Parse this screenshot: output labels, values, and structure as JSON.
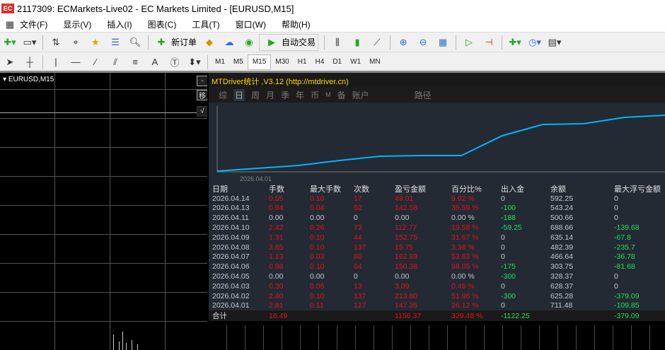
{
  "window": {
    "title": "2117309: ECMarkets-Live02 - EC Markets Limited - [EURUSD,M15]",
    "logo": "EC"
  },
  "menu": [
    "文件(F)",
    "显示(V)",
    "插入(I)",
    "图表(C)",
    "工具(T)",
    "窗口(W)",
    "帮助(H)"
  ],
  "toolbar": {
    "new_order": "新订单",
    "auto_trading": "自动交易"
  },
  "drawing_tools": {
    "text_tool": "A"
  },
  "timeframes": [
    "M1",
    "M5",
    "M15",
    "M30",
    "H1",
    "H4",
    "D1",
    "W1",
    "MN"
  ],
  "active_timeframe": "M15",
  "chart": {
    "symbol": "EURUSD,M15",
    "side_buttons": [
      "-",
      "移",
      "√"
    ]
  },
  "panel": {
    "title": "MTDriver统计 ,V3.12 (http://mtdriver.cn)",
    "tabs": [
      "综",
      "日",
      "周",
      "月",
      "季",
      "年",
      "币",
      "M",
      "备",
      "账户",
      "路径"
    ],
    "active_tab": "日",
    "chart_label": "2026.04.01",
    "equity_curve": [
      0,
      4,
      8,
      15,
      21,
      22,
      22,
      50,
      66,
      67,
      76,
      79
    ],
    "columns": [
      "日期",
      "手数",
      "最大手数",
      "次数",
      "盈亏金额",
      "百分比%",
      "出入金",
      "余额",
      "最大浮亏金额"
    ],
    "rows": [
      [
        "2026.04.14",
        "0.55",
        "0.10",
        "17",
        "49.01",
        "9.02 %",
        "0",
        "592.25",
        "0"
      ],
      [
        "2026.04.13",
        "0.94",
        "0.04",
        "52",
        "142.58",
        "35.59 %",
        "-100",
        "543.24",
        "0"
      ],
      [
        "2026.04.11",
        "0.00",
        "0.00",
        "0",
        "0.00",
        "0.00 %",
        "-188",
        "500.66",
        "0"
      ],
      [
        "2026.04.10",
        "2.42",
        "0.26",
        "73",
        "112.77",
        "19.58 %",
        "-59.25",
        "688.66",
        "-139.68"
      ],
      [
        "2026.04.09",
        "1.31",
        "0.10",
        "44",
        "152.75",
        "31.67 %",
        "0",
        "635.14",
        "-67.8"
      ],
      [
        "2026.04.08",
        "3.65",
        "0.10",
        "137",
        "15.75",
        "3.38 %",
        "0",
        "482.39",
        "-235.7"
      ],
      [
        "2026.04.07",
        "1.13",
        "0.03",
        "80",
        "162.89",
        "53.63 %",
        "0",
        "466.64",
        "-36.78"
      ],
      [
        "2026.04.06",
        "0.98",
        "0.10",
        "64",
        "150.38",
        "98.05 %",
        "-175",
        "303.75",
        "-81.68"
      ],
      [
        "2026.04.05",
        "0.00",
        "0.00",
        "0",
        "0.00",
        "0.00 %",
        "-300",
        "328.37",
        "0"
      ],
      [
        "2026.04.03",
        "0.30",
        "0.06",
        "13",
        "3.09",
        "0.49 %",
        "0",
        "628.37",
        "0"
      ],
      [
        "2026.04.02",
        "2.40",
        "0.10",
        "137",
        "213.80",
        "51.96 %",
        "-300",
        "625.28",
        "-379.09"
      ],
      [
        "2026.04.01",
        "2.81",
        "0.11",
        "127",
        "147.35",
        "26.12 %",
        "0",
        "711.48",
        "-109.85"
      ]
    ],
    "total": [
      "合计",
      "16.49",
      "",
      "",
      "1150.37",
      "329.48 %",
      "-1122.25",
      "",
      "-379.09"
    ],
    "colors": {
      "profit": "#e3111a",
      "negative": "#1ee05a",
      "line": "#00b4ff"
    }
  }
}
